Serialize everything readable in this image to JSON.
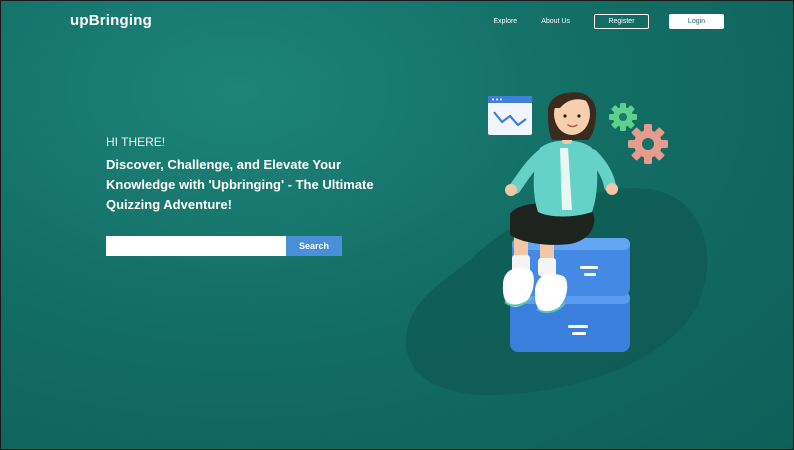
{
  "header": {
    "logo": "upBringing",
    "nav": {
      "explore": "Explore",
      "about": "About Us",
      "register": "Register",
      "login": "Login"
    }
  },
  "hero": {
    "greeting": "HI THERE!",
    "headline": "Discover, Challenge, and Elevate Your Knowledge with 'Upbringing' - The Ultimate Quizzing Adventure!"
  },
  "search": {
    "value": "",
    "button_label": "Search"
  },
  "colors": {
    "background": "#136e66",
    "accent": "#4a90d9",
    "login_text": "#1a5f59"
  },
  "illustration": {
    "icons": [
      "chart-window-icon",
      "gear-icon",
      "gear-icon",
      "storage-box-icon"
    ]
  }
}
